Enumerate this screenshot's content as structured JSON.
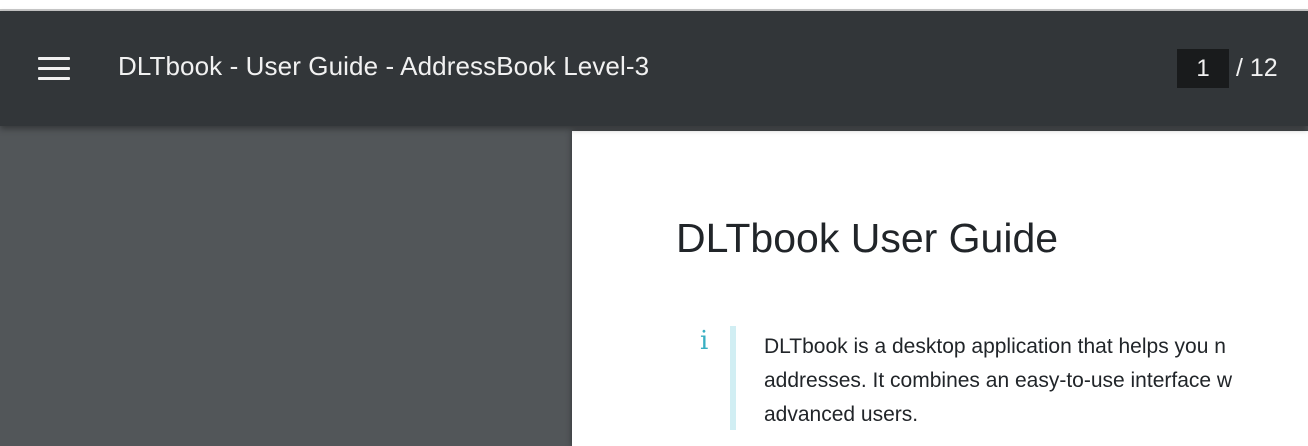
{
  "toolbar": {
    "menu_icon": "hamburger-menu-icon",
    "title": "DLTbook - User Guide - AddressBook Level-3",
    "current_page": "1",
    "page_total": "/ 12"
  },
  "document": {
    "heading": "DLTbook User Guide",
    "callout": {
      "icon": "info-icon",
      "icon_glyph": "i",
      "lines": [
        "DLTbook is a desktop application that helps you n",
        "addresses. It combines an easy-to-use interface w",
        "advanced users."
      ]
    }
  },
  "colors": {
    "toolbar_bg": "#323639",
    "viewer_bg": "#525659",
    "page_bg": "#ffffff",
    "info_accent": "#17a2b8",
    "callout_rule": "#d1eef3"
  }
}
